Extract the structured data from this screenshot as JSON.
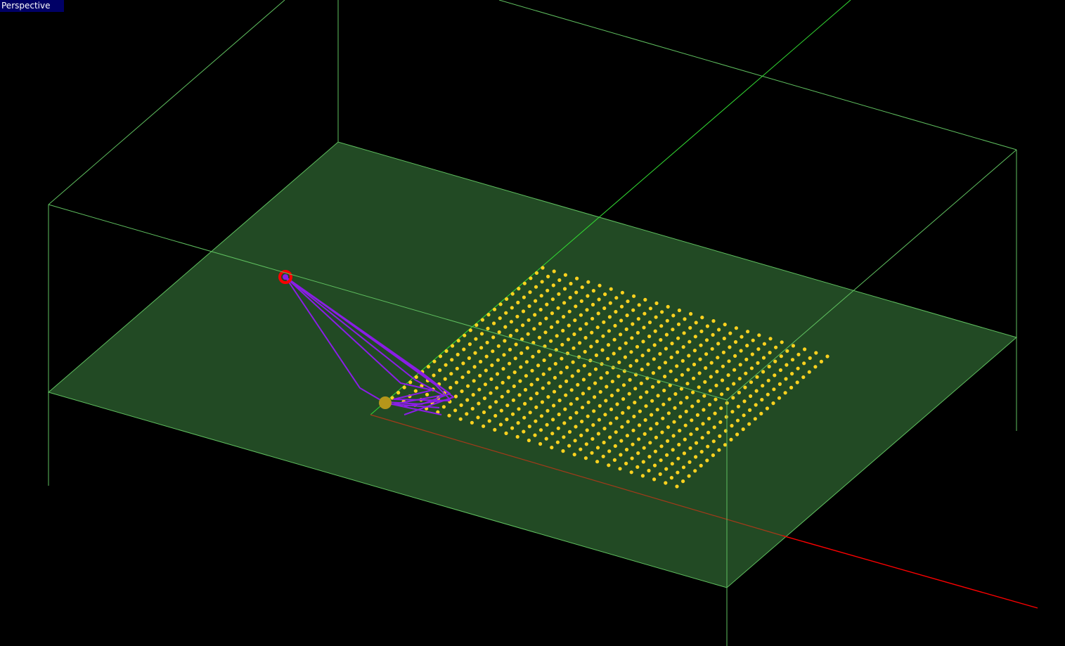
{
  "viewport": {
    "label": "Perspective"
  },
  "colors": {
    "background": "#000000",
    "ground_plane": "#224a24",
    "box_edges": "#5fbf5f",
    "y_axis": "#33dd33",
    "x_axis": "#ff0000",
    "grid_points": "#ffd21e",
    "paths": "#8a1ee6",
    "start_marker": "#ff0000",
    "end_marker": "#b5961a",
    "label_background": "#000066",
    "label_text": "#ffffff"
  },
  "grid_points": {
    "rows": 26,
    "columns": 26
  },
  "paths": {
    "count": 6
  }
}
